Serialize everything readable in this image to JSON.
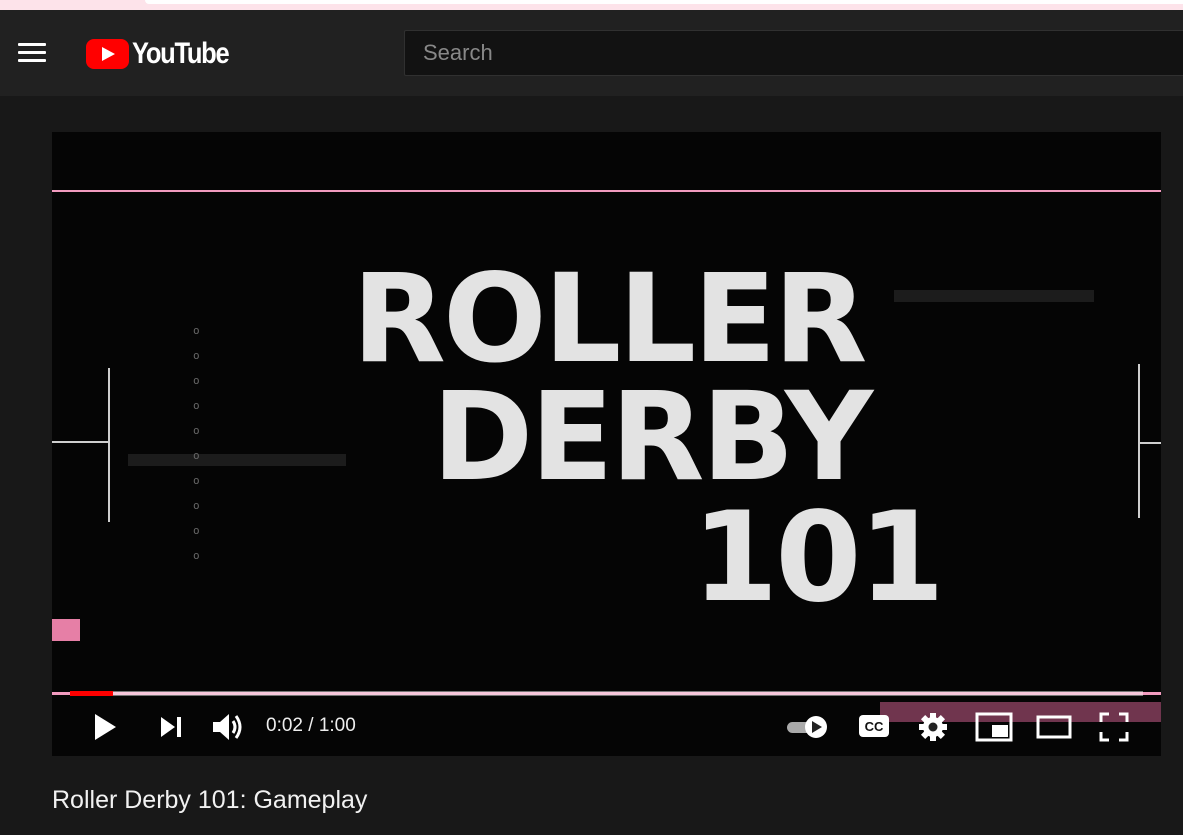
{
  "header": {
    "logo_text": "YouTube",
    "search_placeholder": "Search"
  },
  "video": {
    "title_lines": [
      "ROLLER",
      "DERBY",
      "101"
    ],
    "progress_fraction": 0.04,
    "time_display": "0:02 / 1:00"
  },
  "colors": {
    "accent": "#ff0000",
    "pink": "#f29bbf",
    "background": "#181818"
  },
  "page": {
    "video_title": "Roller Derby 101: Gameplay"
  }
}
